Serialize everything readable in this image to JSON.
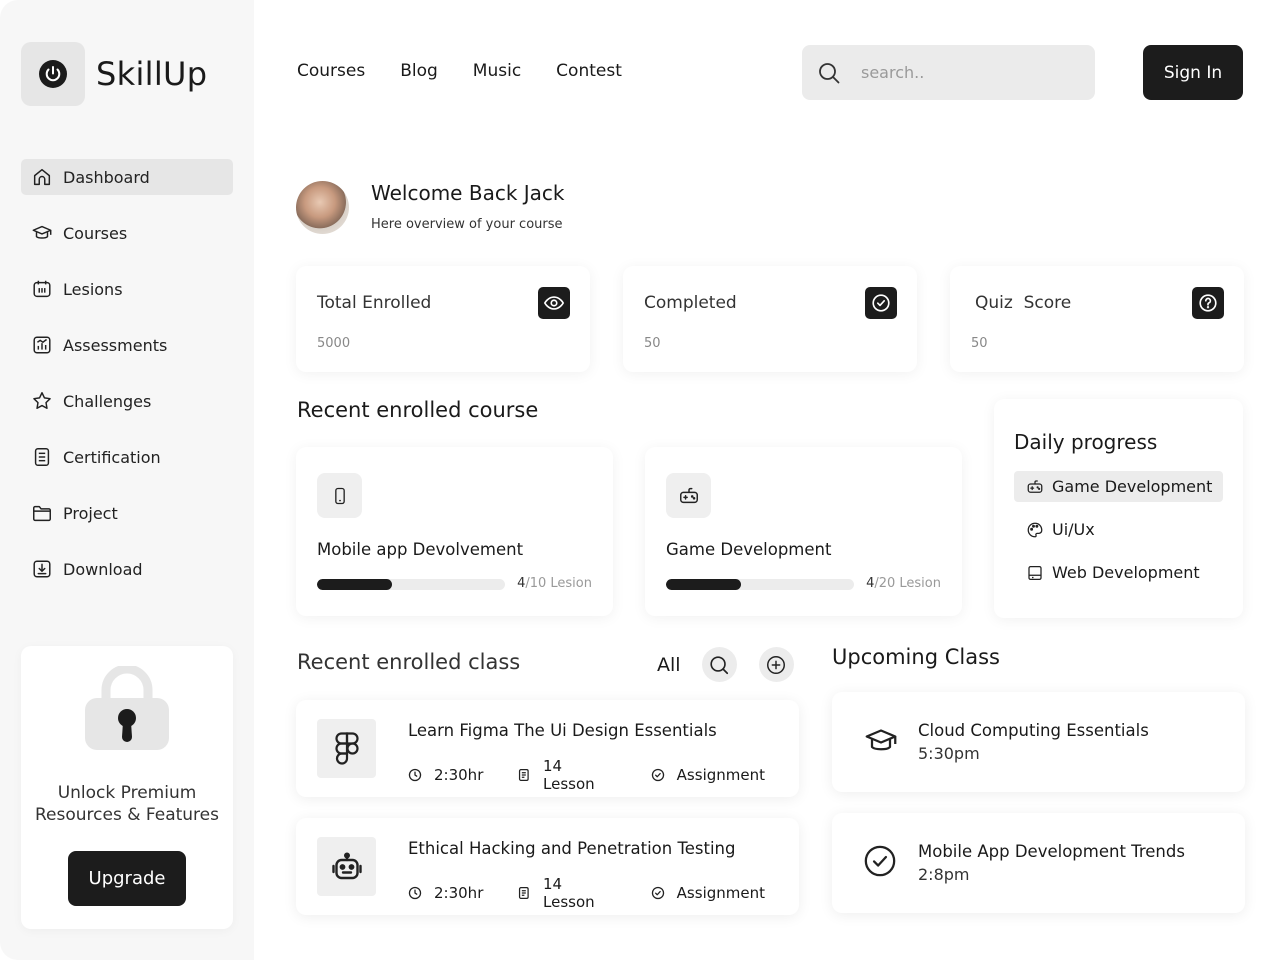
{
  "brand": {
    "name": "SkillUp",
    "icon": "power-icon"
  },
  "sidebar": {
    "items": [
      {
        "label": "Dashboard",
        "icon": "home-icon",
        "active": true
      },
      {
        "label": "Courses",
        "icon": "graduation-cap-icon"
      },
      {
        "label": "Lesions",
        "icon": "calendar-icon"
      },
      {
        "label": "Assessments",
        "icon": "bar-chart-icon"
      },
      {
        "label": "Challenges",
        "icon": "star-icon"
      },
      {
        "label": "Certification",
        "icon": "document-list-icon"
      },
      {
        "label": "Project",
        "icon": "folder-icon"
      },
      {
        "label": "Download",
        "icon": "download-icon"
      }
    ],
    "promo": {
      "text_line1": "Unlock Premium",
      "text_line2": "Resources & Features",
      "button": "Upgrade"
    }
  },
  "topnav": {
    "links": [
      "Courses",
      "Blog",
      "Music",
      "Contest"
    ]
  },
  "search": {
    "placeholder": "search.."
  },
  "signin": "Sign In",
  "welcome": {
    "title": "Welcome Back Jack",
    "subtitle": "Here overview of your course"
  },
  "stats": [
    {
      "label": "Total Enrolled",
      "value": "5000",
      "icon": "eye-icon"
    },
    {
      "label": "Completed",
      "value": "50",
      "icon": "check-circle-icon"
    },
    {
      "label": "Quiz  Score",
      "value": "50",
      "icon": "question-icon"
    }
  ],
  "recent_course": {
    "title": "Recent enrolled course",
    "items": [
      {
        "title": "Mobile app Devolvement",
        "done": "4",
        "total": "/10 Lesion",
        "progress": 0.4,
        "icon": "mobile-icon"
      },
      {
        "title": "Game Development",
        "done": "4",
        "total": "/20 Lesion",
        "progress": 0.4,
        "icon": "gamepad-icon"
      }
    ]
  },
  "daily": {
    "title": "Daily progress",
    "items": [
      {
        "label": "Game Development",
        "icon": "gamepad-icon",
        "active": true
      },
      {
        "label": "Ui/Ux",
        "icon": "palette-icon"
      },
      {
        "label": "Web Development",
        "icon": "monitor-icon"
      }
    ]
  },
  "recent_class": {
    "title": "Recent enrolled class",
    "filter": "All",
    "items": [
      {
        "title": "Learn Figma The Ui Design Essentials",
        "duration": "2:30hr",
        "lessons": "14 Lesson",
        "type": "Assignment",
        "icon": "figma-icon"
      },
      {
        "title": "Ethical Hacking and Penetration Testing",
        "duration": "2:30hr",
        "lessons": "14 Lesson",
        "type": "Assignment",
        "icon": "robot-icon"
      }
    ]
  },
  "upcoming": {
    "title": "Upcoming Class",
    "items": [
      {
        "title": "Cloud Computing Essentials",
        "time": "5:30pm",
        "icon": "graduation-cap-icon"
      },
      {
        "title": "Mobile App Development Trends",
        "time": "2:8pm",
        "icon": "check-circle-icon"
      }
    ]
  }
}
